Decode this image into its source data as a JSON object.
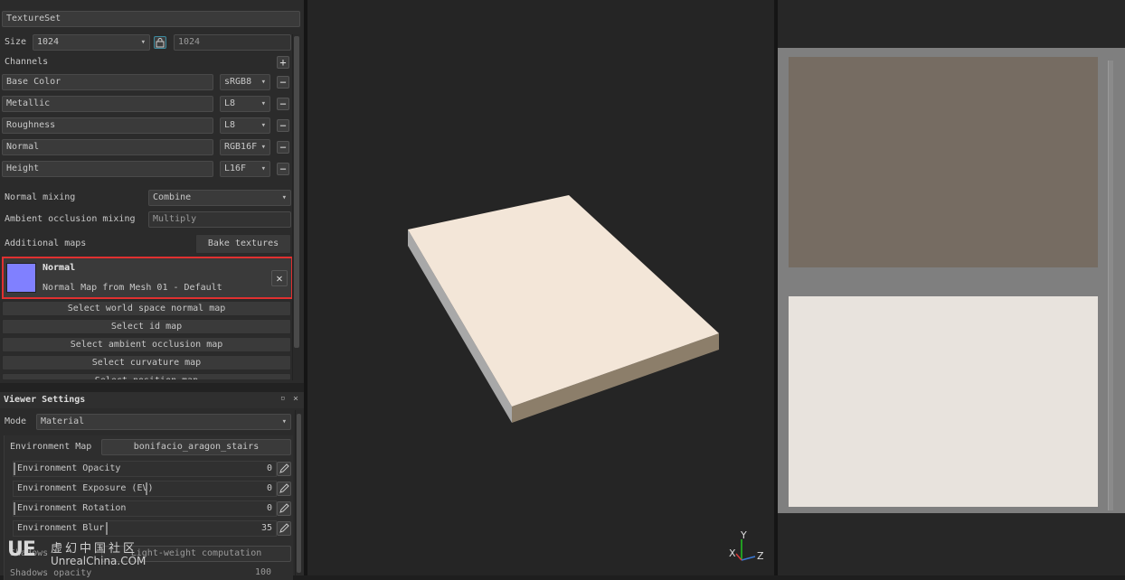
{
  "texture_set": {
    "header": "TextureSet",
    "size_label": "Size",
    "size_value": "1024",
    "size_value_2": "1024",
    "channels_label": "Channels",
    "channels": [
      {
        "name": "Base Color",
        "format": "sRGB8"
      },
      {
        "name": "Metallic",
        "format": "L8"
      },
      {
        "name": "Roughness",
        "format": "L8"
      },
      {
        "name": "Normal",
        "format": "RGB16F"
      },
      {
        "name": "Height",
        "format": "L16F"
      }
    ],
    "normal_mixing_label": "Normal mixing",
    "normal_mixing_value": "Combine",
    "ao_mixing_label": "Ambient occlusion mixing",
    "ao_mixing_value": "Multiply",
    "additional_maps_label": "Additional maps",
    "bake_button": "Bake textures",
    "normal_map_card": {
      "title": "Normal",
      "subtitle": "Normal Map from Mesh 01 - Default",
      "swatch_color": "#8080ff",
      "highlight_color": "#e03030"
    },
    "map_buttons": [
      "Select world space normal map",
      "Select id map",
      "Select ambient occlusion map",
      "Select curvature map",
      "Select position map"
    ]
  },
  "viewer_settings": {
    "title": "Viewer Settings",
    "mode_label": "Mode",
    "mode_value": "Material",
    "env_map_label": "Environment Map",
    "env_map_value": "bonifacio_aragon_stairs",
    "sliders": [
      {
        "label": "Environment Opacity",
        "value": "0",
        "fill": 0
      },
      {
        "label": "Environment Exposure (EV)",
        "value": "0",
        "fill": 0.5
      },
      {
        "label": "Environment Rotation",
        "value": "0",
        "fill": 0
      },
      {
        "label": "Environment Blur",
        "value": "35",
        "fill": 0.35
      }
    ],
    "shadows_label": "Shadows",
    "shadows_value": "Light-weight computation",
    "shadows_opacity_label": "Shadows opacity",
    "shadows_opacity_value": "100"
  },
  "viewport_3d": {
    "axis_x": "X",
    "axis_y": "Y",
    "axis_z": "Z",
    "box_top_color": "#f3e6d8",
    "box_side_color": "#8c7e6a"
  },
  "viewport_2d": {
    "upper_tile_color": "#766c62",
    "lower_tile_color": "#e8e3dd"
  },
  "watermark": {
    "logo": "UE",
    "cn_text": "虚幻中国社区",
    "site": "UnrealChina.COM"
  }
}
